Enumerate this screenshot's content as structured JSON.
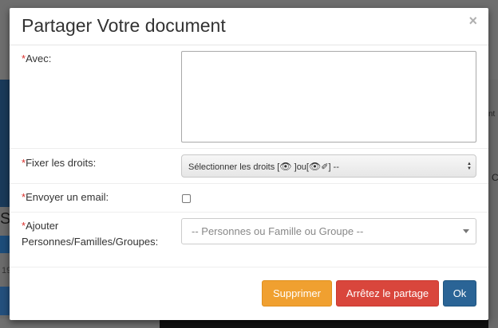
{
  "background": {
    "edge_text": "SE",
    "edge_text_small": "19",
    "right_mark": "nt",
    "right_mark2": "C"
  },
  "modal": {
    "title": "Partager Votre document",
    "close_label": "×"
  },
  "form": {
    "required_mark": "*",
    "avec": {
      "label": "Avec:",
      "value": ""
    },
    "droits": {
      "label": "Fixer les droits:",
      "selected_prefix": "Sélectionner les droits [",
      "eye1": "👁",
      "middle": " ]ou[",
      "eye2": "👁",
      "pencil": "✐",
      "suffix": "] --"
    },
    "email": {
      "label": "Envoyer un email:",
      "checked": false
    },
    "ajouter": {
      "label": "Ajouter Personnes/Familles/Groupes:",
      "placeholder": "-- Personnes ou Famille ou Groupe --"
    }
  },
  "buttons": {
    "supprimer": "Supprimer",
    "arreter": "Arrêtez le partage",
    "ok": "Ok"
  },
  "colors": {
    "required": "#d9302c",
    "supprimer": "#f0a030",
    "arreter": "#d9463c",
    "ok": "#2a6496"
  }
}
